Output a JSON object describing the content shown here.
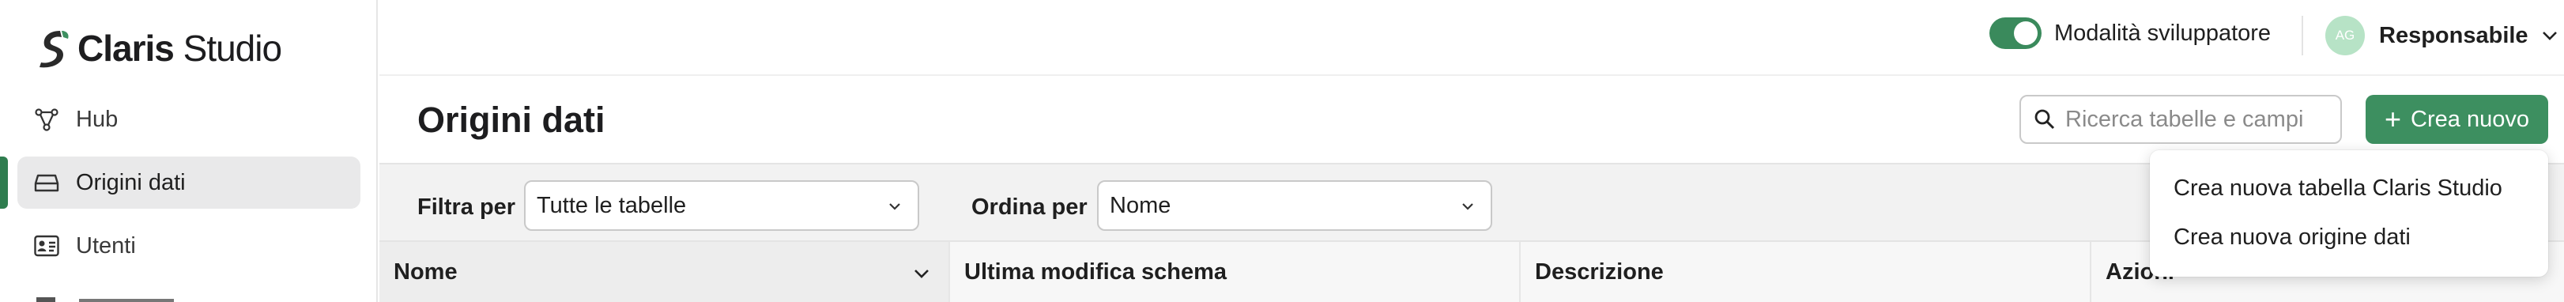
{
  "app": {
    "brand_bold": "Claris",
    "brand_light": "Studio"
  },
  "sidebar": {
    "items": [
      {
        "label": "Hub",
        "icon": "hub-icon",
        "active": false
      },
      {
        "label": "Origini dati",
        "icon": "database-icon",
        "active": true
      },
      {
        "label": "Utenti",
        "icon": "users-card-icon",
        "active": false
      }
    ]
  },
  "topbar": {
    "dev_mode_label": "Modalità sviluppatore",
    "dev_mode_on": true,
    "avatar_initials": "AG",
    "user_role": "Responsabile"
  },
  "page": {
    "title": "Origini dati",
    "search_placeholder": "Ricerca tabelle e campi",
    "create_label": "Crea nuovo"
  },
  "filters": {
    "filter_label": "Filtra per",
    "filter_value": "Tutte le tabelle",
    "sort_label": "Ordina per",
    "sort_value": "Nome"
  },
  "table": {
    "columns": [
      "Nome",
      "Ultima modifica schema",
      "Descrizione",
      "Azioni"
    ]
  },
  "create_menu": {
    "items": [
      "Crea nuova tabella Claris Studio",
      "Crea nuova origine dati"
    ]
  },
  "colors": {
    "accent": "#3d8f60",
    "active_bar": "#2f7d4f",
    "avatar": "#b7e3c6"
  }
}
